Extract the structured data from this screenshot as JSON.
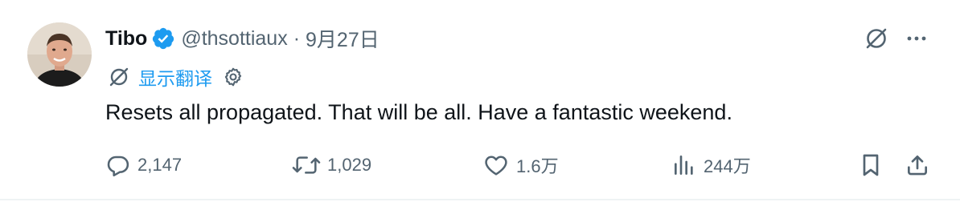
{
  "author": {
    "display_name": "Tibo",
    "handle": "@thsottiaux",
    "separator": "·",
    "date": "9月27日",
    "verified_icon": "verified-badge-icon",
    "avatar": "profile-avatar"
  },
  "translate": {
    "label": "显示翻译",
    "icon": "translate-icon",
    "settings_icon": "gear-icon"
  },
  "tweet": {
    "text": "Resets all propagated. That will be all. Have a fantastic weekend."
  },
  "top_icons": {
    "grok_icon": "grok-icon",
    "more_icon": "more-icon"
  },
  "actions": {
    "replies": "2,147",
    "reposts": "1,029",
    "likes": "1.6万",
    "views": "244万",
    "bookmark_icon": "bookmark-icon",
    "share_icon": "share-icon"
  },
  "colors": {
    "accent": "#1d9bf0",
    "text_primary": "#0f1419",
    "text_secondary": "#536471",
    "border": "#eff3f4"
  }
}
